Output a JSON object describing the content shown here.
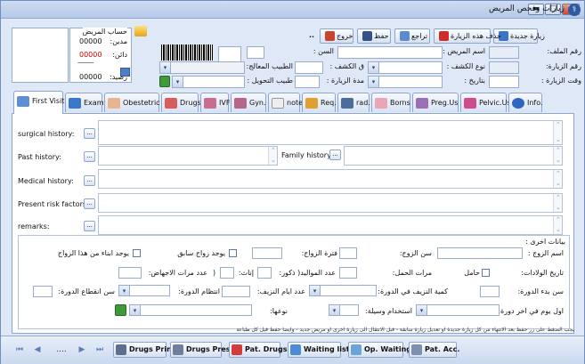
{
  "window": {
    "title": "زيارات وفحص المريض",
    "min": "▬",
    "max": "□",
    "close": "✕"
  },
  "toolbar": {
    "new_visit": "زيارة جديدة",
    "delete_visit": "حذف هذه الزيارة",
    "undo": "تراجع",
    "save": "حفظ",
    "exit": "خروج",
    "more": ".."
  },
  "header": {
    "file_no_label": "رقم الملف:",
    "patient_name_label": "اسم المريض :",
    "visit_no_label": "رقم الزيارة:",
    "exam_type_label": "نوع الكشف :",
    "visit_time_label": "وقت الزيارة :",
    "date_label": "بتاريخ :",
    "age_label": "السن :",
    "exam_fee_label": "ق الكشف :",
    "doctor_label": "الطبيب المعالج:",
    "visit_duration_label": "مدة الزيارة :",
    "referral_doctor_label": "طبيب التحويل :"
  },
  "account": {
    "title": "حساب المريض",
    "debit_label": "مدين:",
    "debit_value": "00000",
    "credit_label": "دائن:",
    "credit_value": "00000",
    "separator": "---------------",
    "balance_label": "رصيد:",
    "balance_value": "00000"
  },
  "tabs": [
    {
      "label": "First Visit",
      "active": true
    },
    {
      "label": "Exam"
    },
    {
      "label": "Obestetric"
    },
    {
      "label": "Drugs"
    },
    {
      "label": "IVF"
    },
    {
      "label": "Gyn."
    },
    {
      "label": "note"
    },
    {
      "label": "Req."
    },
    {
      "label": "rad."
    },
    {
      "label": "Borns"
    },
    {
      "label": "Preg.Us"
    },
    {
      "label": "Pelvic.Us"
    },
    {
      "label": "Info."
    }
  ],
  "history": {
    "surgical": "surgical history:",
    "past": "Past history:",
    "family": "Family history:",
    "medical": "Medical history:",
    "present_risk": "Present risk factors:",
    "remarks": "remarks:",
    "dots": "..."
  },
  "other": {
    "title": "بيانات اخرى :",
    "husband_name": "اسم الزوج :",
    "husband_age": "سن الزوج:",
    "marriage_period": "فترة الزواج:",
    "prev_marriage": "يوجد زواج سابق",
    "children_from_marriage": "يوجد ابناء من هذا الزواج",
    "births_history": "تاريخ الولادات:",
    "pregnant": "حامل",
    "pregnancy_times": "مرات الحمل:",
    "births_count": "عدد المواليد( ذكور:",
    "females": "إناث:",
    "close_paren": ")",
    "abortions": "عدد مرات الاجهاض:",
    "menarche_age": "سن بدء الدورة:",
    "bleeding_amount": "كمية النزيف في الدورة:",
    "bleeding_days": "عدد ايام النزيف:",
    "cycle_regularity": "انتظام الدورة:",
    "menopause_age": "سن انقطاع الدورة:",
    "last_period": "اول يوم في اخر دورة:",
    "contraception": "استخدام وسيلة:",
    "type": "نوعها:"
  },
  "note": "يجب الضغط على زر حفظ بعد الانتهاء من كل زيارة جديدة او تعديل زيارة سابقة - قبل الانتقال الى زيارة اخرى او مريض جديد - وايضا حفظ قبل كل طباعة",
  "bottombar": {
    "first": "⏮",
    "prev": "◀",
    "pages": "....",
    "next": "▶",
    "last": "⏭",
    "drugs_print": "Drugs Print",
    "drugs_pres": "Drugs Pres.",
    "pat_drugs": "Pat. Drugs",
    "waiting_list": "Waiting list",
    "op_waiting": "Op. Waiting",
    "pat_acc": "Pat. Acc."
  },
  "colors": {
    "accent": "#2d5aa0",
    "titlebar": "#b5c9e8",
    "panel": "#dfe8f6",
    "debit": "#cc0000"
  }
}
